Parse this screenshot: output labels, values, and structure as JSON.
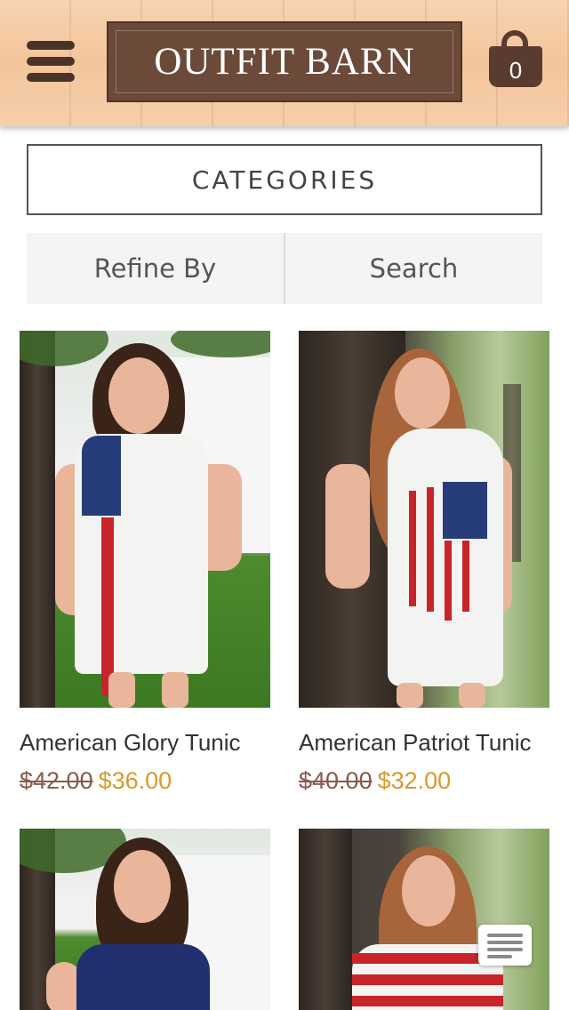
{
  "header": {
    "menu_icon": "hamburger-menu-icon",
    "logo_text": "OUTFIT BARN",
    "cart_icon": "shopping-bag-icon",
    "cart_count": "0"
  },
  "nav": {
    "categories_label": "CATEGORIES",
    "refine_label": "Refine By",
    "search_label": "Search"
  },
  "products": [
    {
      "name": "American Glory Tunic",
      "old_price": "$42.00",
      "new_price": "$36.00"
    },
    {
      "name": "American Patriot Tunic",
      "old_price": "$40.00",
      "new_price": "$32.00"
    },
    {
      "name": "",
      "old_price": "",
      "new_price": ""
    },
    {
      "name": "",
      "old_price": "",
      "new_price": ""
    }
  ],
  "chat": {
    "icon": "chat-lines-icon"
  },
  "colors": {
    "brand_brown": "#6b4a3a",
    "sale_price": "#d99a2b",
    "old_price": "#8a5a4a"
  }
}
